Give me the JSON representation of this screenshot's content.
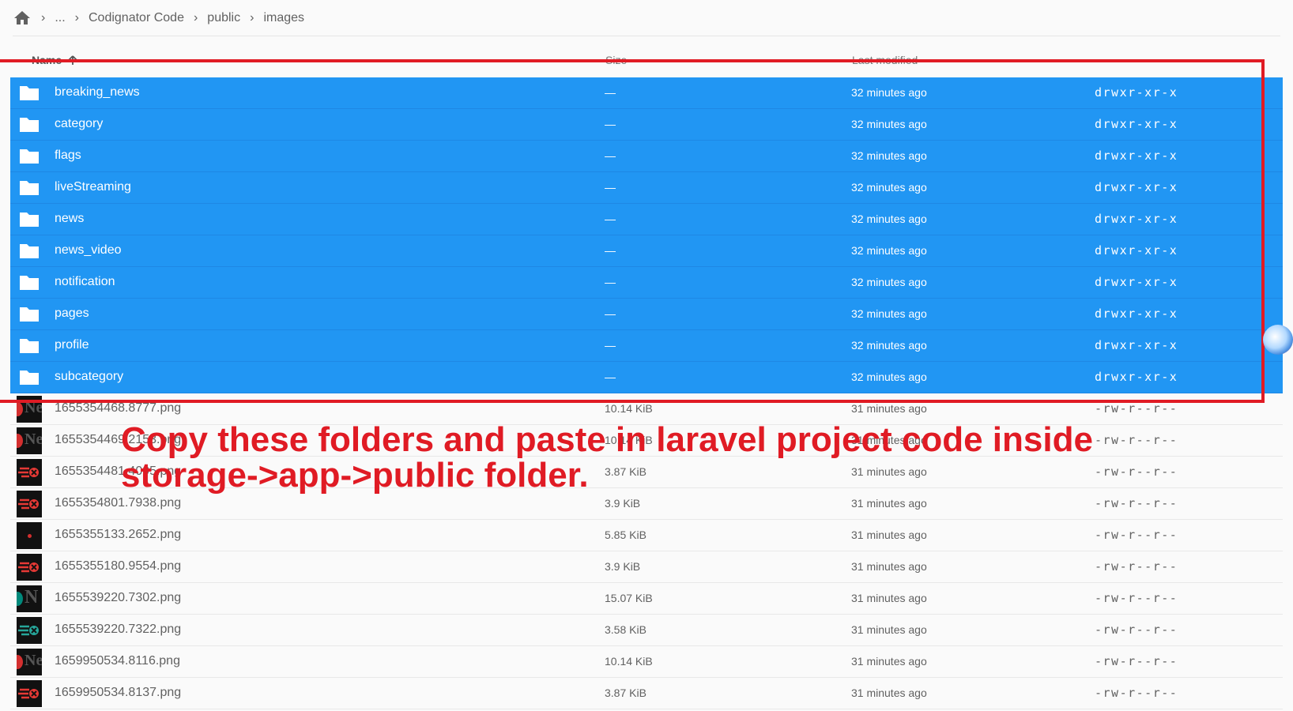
{
  "breadcrumb": {
    "items": [
      "...",
      "Codignator Code",
      "public",
      "images"
    ]
  },
  "columns": {
    "name": "Name",
    "size": "Size",
    "modified": "Last modified"
  },
  "folders": [
    {
      "name": "breaking_news",
      "size": "—",
      "modified": "32 minutes ago",
      "perm": "drwxr-xr-x"
    },
    {
      "name": "category",
      "size": "—",
      "modified": "32 minutes ago",
      "perm": "drwxr-xr-x"
    },
    {
      "name": "flags",
      "size": "—",
      "modified": "32 minutes ago",
      "perm": "drwxr-xr-x"
    },
    {
      "name": "liveStreaming",
      "size": "—",
      "modified": "32 minutes ago",
      "perm": "drwxr-xr-x"
    },
    {
      "name": "news",
      "size": "—",
      "modified": "32 minutes ago",
      "perm": "drwxr-xr-x"
    },
    {
      "name": "news_video",
      "size": "—",
      "modified": "32 minutes ago",
      "perm": "drwxr-xr-x"
    },
    {
      "name": "notification",
      "size": "—",
      "modified": "32 minutes ago",
      "perm": "drwxr-xr-x"
    },
    {
      "name": "pages",
      "size": "—",
      "modified": "32 minutes ago",
      "perm": "drwxr-xr-x"
    },
    {
      "name": "profile",
      "size": "—",
      "modified": "32 minutes ago",
      "perm": "drwxr-xr-x"
    },
    {
      "name": "subcategory",
      "size": "—",
      "modified": "32 minutes ago",
      "perm": "drwxr-xr-x"
    }
  ],
  "files": [
    {
      "name": "1655354468.8777.png",
      "size": "10.14 KiB",
      "modified": "31 minutes ago",
      "perm": "-rw-r--r--",
      "thumb": "ne-red"
    },
    {
      "name": "1655354469.2153.png",
      "size": "10.14 KiB",
      "modified": "31 minutes ago",
      "perm": "-rw-r--r--",
      "thumb": "ne-red"
    },
    {
      "name": "1655354481.4095.png",
      "size": "3.87 KiB",
      "modified": "31 minutes ago",
      "perm": "-rw-r--r--",
      "thumb": "red-icon"
    },
    {
      "name": "1655354801.7938.png",
      "size": "3.9 KiB",
      "modified": "31 minutes ago",
      "perm": "-rw-r--r--",
      "thumb": "red-icon"
    },
    {
      "name": "1655355133.2652.png",
      "size": "5.85 KiB",
      "modified": "31 minutes ago",
      "perm": "-rw-r--r--",
      "thumb": "red-dot"
    },
    {
      "name": "1655355180.9554.png",
      "size": "3.9 KiB",
      "modified": "31 minutes ago",
      "perm": "-rw-r--r--",
      "thumb": "red-icon"
    },
    {
      "name": "1655539220.7302.png",
      "size": "15.07 KiB",
      "modified": "31 minutes ago",
      "perm": "-rw-r--r--",
      "thumb": "n-teal"
    },
    {
      "name": "1655539220.7322.png",
      "size": "3.58 KiB",
      "modified": "31 minutes ago",
      "perm": "-rw-r--r--",
      "thumb": "teal-icon"
    },
    {
      "name": "1659950534.8116.png",
      "size": "10.14 KiB",
      "modified": "31 minutes ago",
      "perm": "-rw-r--r--",
      "thumb": "ne-red"
    },
    {
      "name": "1659950534.8137.png",
      "size": "3.87 KiB",
      "modified": "31 minutes ago",
      "perm": "-rw-r--r--",
      "thumb": "red-icon"
    }
  ],
  "annotation": {
    "line1": "Copy these folders and paste in laravel project code inside",
    "line2": "storage->app->public folder."
  },
  "colors": {
    "selection": "#2196f3",
    "annotation": "#e01b24"
  }
}
